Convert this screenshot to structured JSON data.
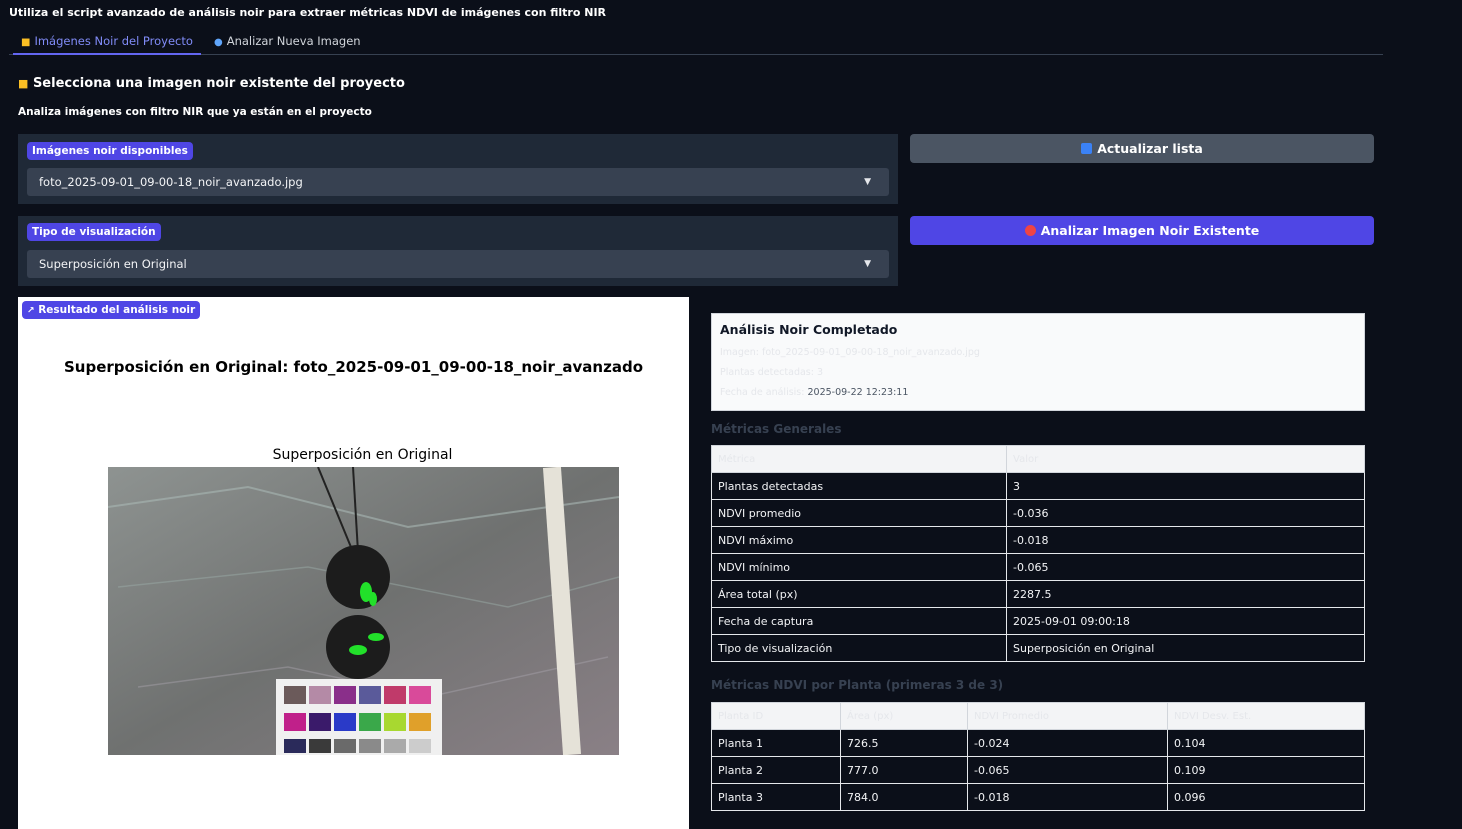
{
  "description": "Utiliza el script avanzado de análisis noir para extraer métricas NDVI de imágenes con filtro NIR",
  "tabs": [
    {
      "label": "Imágenes Noir del Proyecto",
      "icon": "folder-icon"
    },
    {
      "label": "Analizar Nueva Imagen",
      "icon": "magnifier-icon"
    }
  ],
  "section": {
    "title": "Selecciona una imagen noir existente del proyecto",
    "subtitle": "Analiza imágenes con filtro NIR que ya están en el proyecto"
  },
  "image_select": {
    "label": "Imágenes noir disponibles",
    "value": "foto_2025-09-01_09-00-18_noir_avanzado.jpg"
  },
  "viz_select": {
    "label": "Tipo de visualización",
    "value": "Superposición en Original"
  },
  "buttons": {
    "refresh": "Actualizar lista",
    "analyze": "Analizar Imagen Noir Existente"
  },
  "result": {
    "label": "Resultado del análisis noir",
    "figure_title": "Superposición en Original: foto_2025-09-01_09-00-18_noir_avanzado",
    "subplot_title": "Superposición en Original"
  },
  "summary": {
    "title": "Análisis Noir Completado",
    "line1": "Imagen: foto_2025-09-01_09-00-18_noir_avanzado.jpg",
    "line2": "Plantas detectadas: 3",
    "line3_label": "Fecha de análisis:",
    "line3_value": "2025-09-22 12:23:11"
  },
  "general": {
    "heading": "Métricas Generales",
    "columns": [
      "Métrica",
      "Valor"
    ],
    "rows": [
      [
        "Plantas detectadas",
        "3"
      ],
      [
        "NDVI promedio",
        "-0.036"
      ],
      [
        "NDVI máximo",
        "-0.018"
      ],
      [
        "NDVI mínimo",
        "-0.065"
      ],
      [
        "Área total (px)",
        "2287.5"
      ],
      [
        "Fecha de captura",
        "2025-09-01 09:00:18"
      ],
      [
        "Tipo de visualización",
        "Superposición en Original"
      ]
    ]
  },
  "plants": {
    "heading": "Métricas NDVI por Planta (primeras 3 de 3)",
    "columns": [
      "Planta ID",
      "Área (px)",
      "NDVI Promedio",
      "NDVI Desv. Est."
    ],
    "rows": [
      [
        "Planta 1",
        "726.5",
        "-0.024",
        "0.104"
      ],
      [
        "Planta 2",
        "777.0",
        "-0.065",
        "0.109"
      ],
      [
        "Planta 3",
        "784.0",
        "-0.018",
        "0.096"
      ]
    ]
  },
  "colors": {
    "accent": "#4f46e5",
    "bg": "#0b0f19",
    "panel": "#1f2937"
  }
}
